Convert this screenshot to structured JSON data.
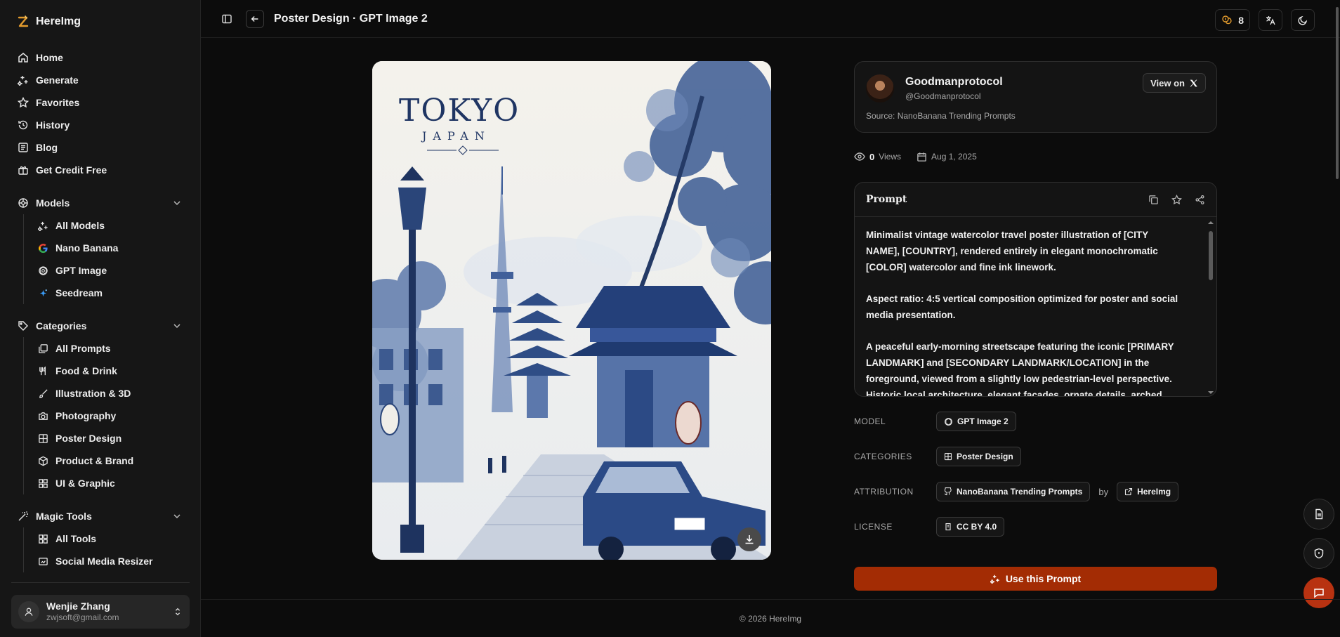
{
  "brand": {
    "name": "HereImg",
    "accent": "#e39b2d"
  },
  "nav": [
    {
      "label": "Home",
      "icon": "home-icon"
    },
    {
      "label": "Generate",
      "icon": "sparkle-icon"
    },
    {
      "label": "Favorites",
      "icon": "star-icon"
    },
    {
      "label": "History",
      "icon": "history-icon"
    },
    {
      "label": "Blog",
      "icon": "blog-icon"
    },
    {
      "label": "Get Credit Free",
      "icon": "gift-icon"
    }
  ],
  "models": {
    "label": "Models",
    "items": [
      {
        "label": "All Models",
        "icon": "sparkle-icon"
      },
      {
        "label": "Nano Banana",
        "icon": "google-icon"
      },
      {
        "label": "GPT Image",
        "icon": "openai-icon"
      },
      {
        "label": "Seedream",
        "icon": "seedream-icon"
      }
    ]
  },
  "categories": {
    "label": "Categories",
    "items": [
      {
        "label": "All Prompts",
        "icon": "stack-icon"
      },
      {
        "label": "Food & Drink",
        "icon": "utensils-icon"
      },
      {
        "label": "Illustration & 3D",
        "icon": "brush-icon"
      },
      {
        "label": "Photography",
        "icon": "camera-icon"
      },
      {
        "label": "Poster Design",
        "icon": "layout-icon"
      },
      {
        "label": "Product & Brand",
        "icon": "box-icon"
      },
      {
        "label": "UI & Graphic",
        "icon": "grid-icon"
      }
    ]
  },
  "magic_tools": {
    "label": "Magic Tools",
    "items": [
      {
        "label": "All Tools",
        "icon": "grid-icon"
      },
      {
        "label": "Social Media Resizer",
        "icon": "image-resize-icon"
      }
    ]
  },
  "user": {
    "name": "Wenjie Zhang",
    "email": "zwjsoft@gmail.com"
  },
  "topbar": {
    "title": "Poster Design · GPT Image 2",
    "credits": "8"
  },
  "poster": {
    "title": "TOKYO",
    "subtitle": "JAPAN"
  },
  "author": {
    "name": "Goodmanprotocol",
    "handle": "@Goodmanprotocol",
    "source": "Source: NanoBanana Trending Prompts",
    "view_label": "View on"
  },
  "stats": {
    "views": "0",
    "views_label": "Views",
    "date": "Aug 1, 2025"
  },
  "prompt": {
    "title": "Prompt",
    "paragraphs": [
      "Minimalist vintage watercolor travel poster illustration of [CITY NAME], [COUNTRY], rendered entirely in elegant monochromatic [COLOR] watercolor and fine ink linework.",
      "Aspect ratio: 4:5 vertical composition optimized for poster and social media presentation.",
      "A peaceful early-morning streetscape featuring the iconic [PRIMARY LANDMARK] and [SECONDARY LANDMARK/LOCATION] in the foreground, viewed from a slightly low pedestrian-level perspective. Historic local architecture, elegant facades, ornate details, arched"
    ]
  },
  "info": {
    "model_label": "MODEL",
    "model_value": "GPT Image 2",
    "categories_label": "CATEGORIES",
    "categories_value": "Poster Design",
    "attribution_label": "ATTRIBUTION",
    "attribution_source": "NanoBanana Trending Prompts",
    "attribution_by": "by",
    "attribution_site": "HereImg",
    "license_label": "LICENSE",
    "license_value": "CC BY 4.0"
  },
  "cta": {
    "label": "Use this Prompt",
    "color": "#a32c04"
  },
  "footer": {
    "text": "© 2026 HereImg"
  }
}
